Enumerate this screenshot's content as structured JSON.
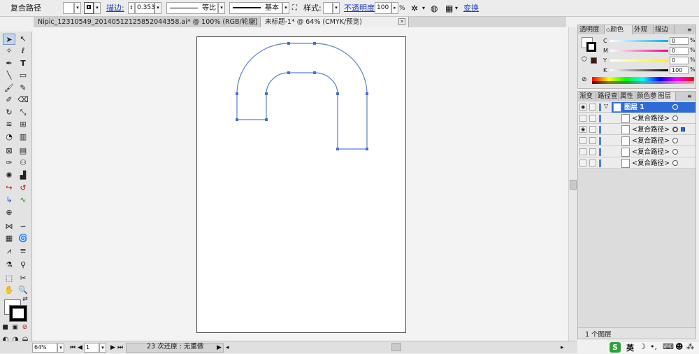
{
  "control_bar": {
    "selection_type": "复合路径",
    "stroke_label": "描边:",
    "stroke_weight": "0.353",
    "profile_label": "等比",
    "brush_label": "基本",
    "style_label": "样式:",
    "opacity_label": "不透明度:",
    "opacity_value": "100",
    "opacity_unit": "%",
    "transform_label": "变换"
  },
  "tabs": [
    {
      "label": "Nipic_12310549_20140512125852044358.ai* @ 100% (RGB/轮廓)"
    },
    {
      "label": "未标题-1* @ 64% (CMYK/预览)"
    }
  ],
  "color_panel": {
    "tabs": [
      "透明度",
      "颜色",
      "外观",
      "描边"
    ],
    "active_tab": "颜色",
    "sliders": [
      {
        "label": "C",
        "value": "0",
        "color": "#00aeef"
      },
      {
        "label": "M",
        "value": "0",
        "color": "#ec008c"
      },
      {
        "label": "Y",
        "value": "0",
        "color": "#fff200"
      },
      {
        "label": "K",
        "value": "100",
        "color": "#000000"
      }
    ],
    "unit": "%"
  },
  "layers_panel": {
    "tabs": [
      "渐变",
      "路径查",
      "属性",
      "颜色参",
      "图层"
    ],
    "active_tab": "图层",
    "layer_name": "图层 1",
    "items": [
      {
        "name": "<复合路径>"
      },
      {
        "name": "<复合路径>"
      },
      {
        "name": "<复合路径>"
      },
      {
        "name": "<复合路径>"
      },
      {
        "name": "<复合路径>"
      }
    ],
    "footer": "1 个图层"
  },
  "status_bar": {
    "zoom": "64%",
    "artboard": "1",
    "history": "23 次还原 : 无重做"
  },
  "ime": {
    "lang": "英"
  }
}
